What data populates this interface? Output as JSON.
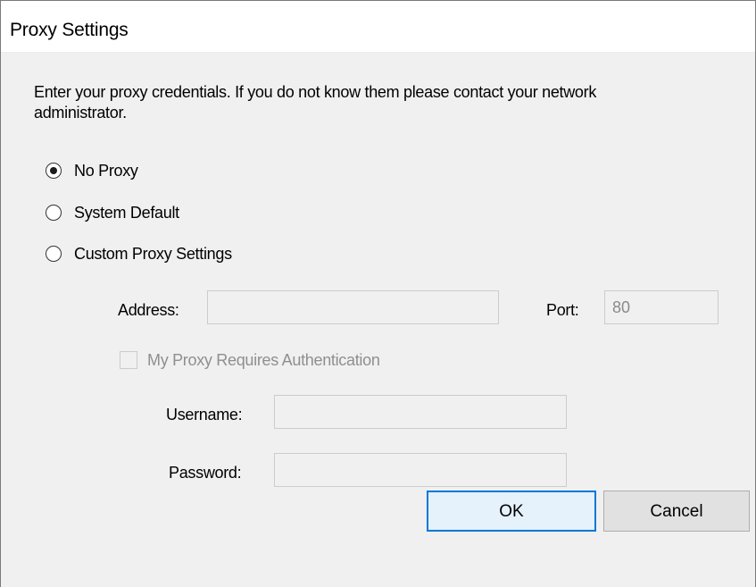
{
  "window": {
    "title": "Proxy Settings"
  },
  "intro_text": "Enter your proxy credentials. If you do not know them please contact your network administrator.",
  "proxy_options": [
    {
      "label": "No Proxy",
      "checked": true
    },
    {
      "label": "System Default",
      "checked": false
    },
    {
      "label": "Custom Proxy Settings",
      "checked": false
    }
  ],
  "address": {
    "label": "Address:",
    "value": ""
  },
  "port": {
    "label": "Port:",
    "value": "80"
  },
  "auth": {
    "label": "My Proxy Requires Authentication",
    "checked": false,
    "enabled": false
  },
  "username": {
    "label": "Username:",
    "value": ""
  },
  "password": {
    "label": "Password:",
    "value": ""
  },
  "buttons": {
    "ok": "OK",
    "cancel": "Cancel"
  },
  "colors": {
    "accent": "#0078d7",
    "dialog_bg": "#f0f0f0",
    "disabled_text": "#8f8f8f"
  }
}
